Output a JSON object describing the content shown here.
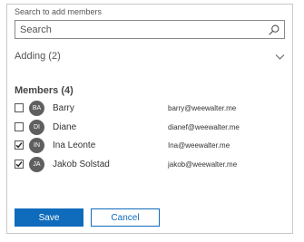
{
  "search": {
    "label": "Search to add members",
    "placeholder": "Search"
  },
  "adding": {
    "label": "Adding (2)"
  },
  "members": {
    "heading": "Members (4)",
    "items": [
      {
        "initials": "BA",
        "name": "Barry",
        "email": "barry@weewalter.me",
        "checked": false
      },
      {
        "initials": "DI",
        "name": "Diane",
        "email": "dianef@weewalter.me",
        "checked": false
      },
      {
        "initials": "IN",
        "name": "Ina Leonte",
        "email": "Ina@weewalter.me",
        "checked": true
      },
      {
        "initials": "JA",
        "name": "Jakob Solstad",
        "email": "jakob@weewalter.me",
        "checked": true
      }
    ]
  },
  "actions": {
    "save_label": "Save",
    "cancel_label": "Cancel"
  },
  "colors": {
    "accent": "#0f6cbd",
    "avatar": "#5f5f5f",
    "border": "#c8c8c8"
  },
  "icons": {
    "search": "search-icon",
    "expand": "chevron-down-icon",
    "check": "checkmark-icon"
  }
}
